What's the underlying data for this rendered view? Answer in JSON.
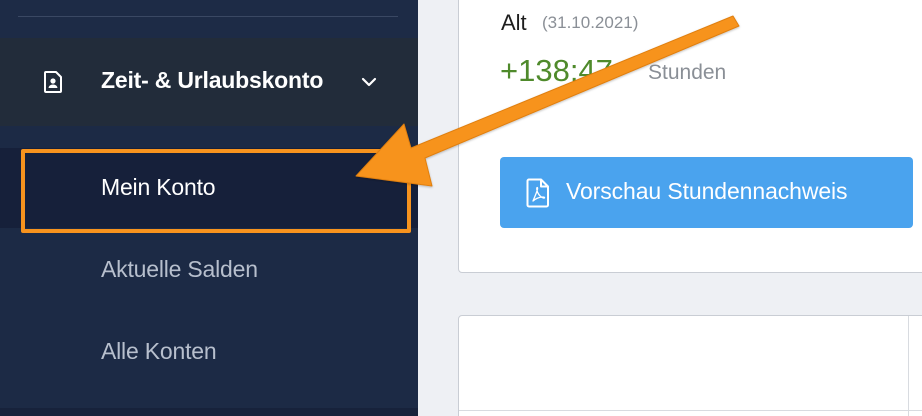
{
  "sidebar": {
    "group": {
      "label": "Zeit- & Urlaubskonto",
      "icon": "user-document-icon",
      "expanded": true
    },
    "items": [
      {
        "label": "Mein Konto",
        "active": true
      },
      {
        "label": "Aktuelle Salden",
        "active": false
      },
      {
        "label": "Alle Konten",
        "active": false
      }
    ]
  },
  "main": {
    "balance": {
      "label": "Alt",
      "date": "(31.10.2021)",
      "value": "+138:47",
      "unit": "Stunden"
    },
    "preview_button": {
      "label": "Vorschau Stundennachweis",
      "icon": "pdf-icon"
    }
  },
  "colors": {
    "sidebar_bg": "#1c2a45",
    "group_bg": "#222c3a",
    "active_bg": "#16203a",
    "accent_orange": "#f7931e",
    "button_blue": "#4aa3ee",
    "value_green": "#4f8a2b"
  }
}
